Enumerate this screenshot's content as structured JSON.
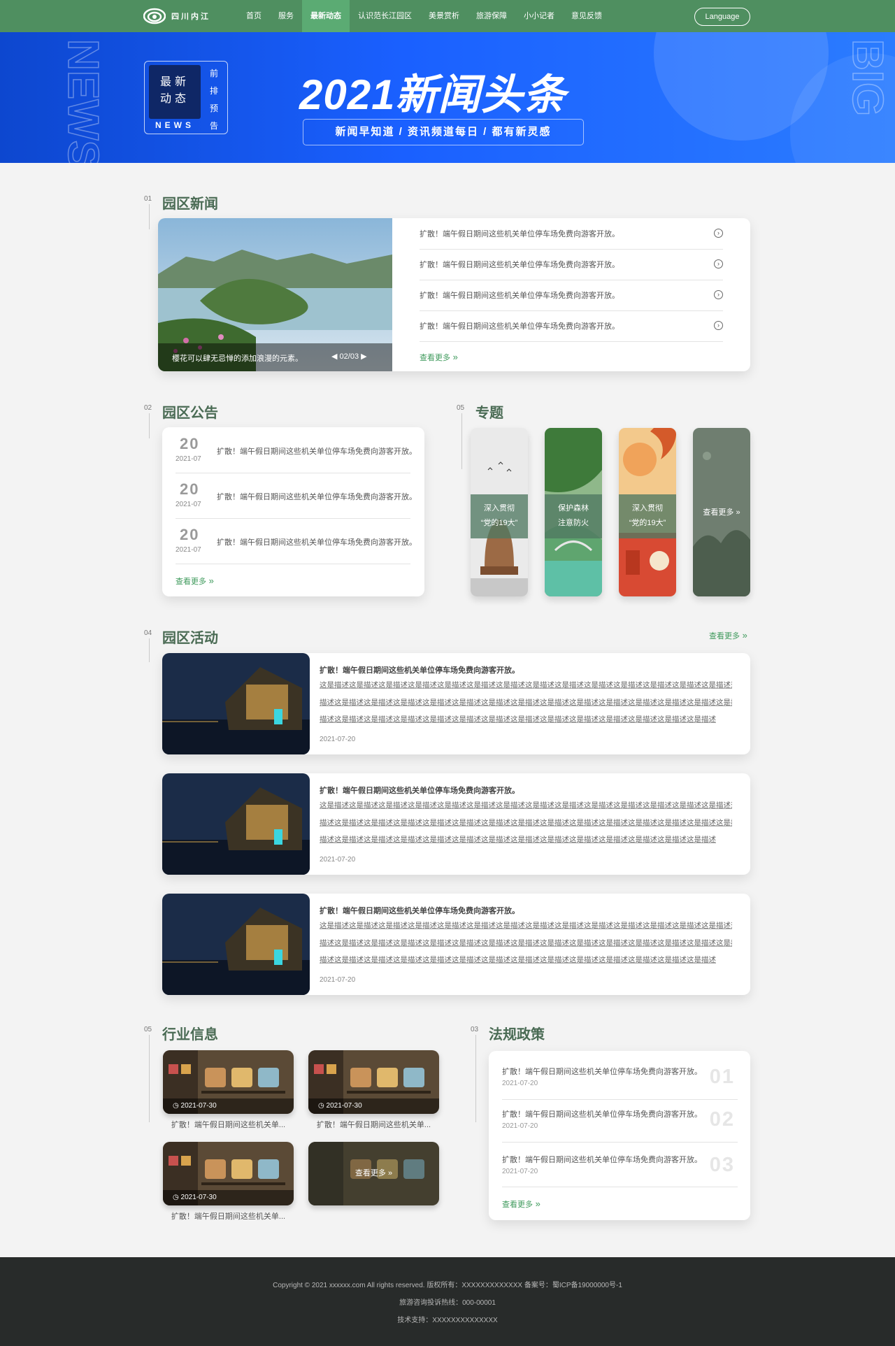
{
  "header": {
    "logo_text": "四川内江",
    "nav": [
      "首页",
      "服务",
      "最新动态",
      "认识范长江园区",
      "美景赏析",
      "旅游保障",
      "小小记者",
      "意见反馈"
    ],
    "active_index": 2,
    "language_button": "Language"
  },
  "banner": {
    "badge_main_line1": "最新",
    "badge_main_line2": "动态",
    "badge_vertical": [
      "前",
      "排",
      "预",
      "告"
    ],
    "badge_news": "NEWS",
    "title": "2021新闻头条",
    "subtitle": "新闻早知道  /  资讯频道每日  /  都有新灵感",
    "ghost_left": "NEWS",
    "ghost_right": "BIG"
  },
  "park_news": {
    "no": "01",
    "title": "园区新闻",
    "caption": "樱花可以肆无忌惮的添加浪漫的元素。",
    "pager": "02/03",
    "items": [
      "扩散！端午假日期间这些机关单位停车场免费向游客开放。",
      "扩散！端午假日期间这些机关单位停车场免费向游客开放。",
      "扩散！端午假日期间这些机关单位停车场免费向游客开放。",
      "扩散！端午假日期间这些机关单位停车场免费向游客开放。"
    ],
    "more": "查看更多"
  },
  "park_notice": {
    "no": "02",
    "title": "园区公告",
    "items": [
      {
        "day": "20",
        "ym": "2021-07",
        "text": "扩散！端午假日期间这些机关单位停车场免费向游客开放。"
      },
      {
        "day": "20",
        "ym": "2021-07",
        "text": "扩散！端午假日期间这些机关单位停车场免费向游客开放。"
      },
      {
        "day": "20",
        "ym": "2021-07",
        "text": "扩散！端午假日期间这些机关单位停车场免费向游客开放。"
      }
    ],
    "more": "查看更多"
  },
  "topics": {
    "no": "05",
    "title": "专题",
    "items": [
      {
        "line1": "深入贯彻",
        "line2": "“党的19大”"
      },
      {
        "line1": "保护森林",
        "line2": "注意防火"
      },
      {
        "line1": "深入贯彻",
        "line2": "“党的19大”"
      }
    ],
    "more": "查看更多"
  },
  "activities": {
    "no": "04",
    "title": "园区活动",
    "more": "查看更多",
    "items": [
      {
        "title": "扩散！端午假日期间这些机关单位停车场免费向游客开放。",
        "lines": [
          "这是描述这是描述这是描述这是描述这是描述这是描述这是描述这是描述这是描述这是描述这是描述这是描述这是描述这是描述这是描述这是描述这是",
          "描述这是描述这是描述这是描述这是描述这是描述这是描述这是描述这是描述这是描述这是描述这是描述这是描述这是描述这是描述这是描述这是描述这是",
          "描述这是描述这是描述这是描述这是描述这是描述这是描述这是描述这是描述这是描述这是描述这是描述这是描述这是描述"
        ],
        "date": "2021-07-20"
      },
      {
        "title": "扩散！端午假日期间这些机关单位停车场免费向游客开放。",
        "lines": [
          "这是描述这是描述这是描述这是描述这是描述这是描述这是描述这是描述这是描述这是描述这是描述这是描述这是描述这是描述这是描述这是描述这是",
          "描述这是描述这是描述这是描述这是描述这是描述这是描述这是描述这是描述这是描述这是描述这是描述这是描述这是描述这是描述这是描述这是描述这是",
          "描述这是描述这是描述这是描述这是描述这是描述这是描述这是描述这是描述这是描述这是描述这是描述这是描述这是描述"
        ],
        "date": "2021-07-20"
      },
      {
        "title": "扩散！端午假日期间这些机关单位停车场免费向游客开放。",
        "lines": [
          "这是描述这是描述这是描述这是描述这是描述这是描述这是描述这是描述这是描述这是描述这是描述这是描述这是描述这是描述这是描述这是描述这是",
          "描述这是描述这是描述这是描述这是描述这是描述这是描述这是描述这是描述这是描述这是描述这是描述这是描述这是描述这是描述这是描述这是描述这是",
          "描述这是描述这是描述这是描述这是描述这是描述这是描述这是描述这是描述这是描述这是描述这是描述这是描述这是描述"
        ],
        "date": "2021-07-20"
      }
    ]
  },
  "industry": {
    "no": "05",
    "title": "行业信息",
    "items": [
      {
        "date": "2021-07-30",
        "caption": "扩散！端午假日期间这些机关单..."
      },
      {
        "date": "2021-07-30",
        "caption": "扩散！端午假日期间这些机关单..."
      },
      {
        "date": "2021-07-30",
        "caption": "扩散！端午假日期间这些机关单..."
      }
    ],
    "more": "查看更多"
  },
  "laws": {
    "no": "03",
    "title": "法规政策",
    "items": [
      {
        "text": "扩散！端午假日期间这些机关单位停车场免费向游客开放。",
        "date": "2021-07-20",
        "no": "01"
      },
      {
        "text": "扩散！端午假日期间这些机关单位停车场免费向游客开放。",
        "date": "2021-07-20",
        "no": "02"
      },
      {
        "text": "扩散！端午假日期间这些机关单位停车场免费向游客开放。",
        "date": "2021-07-20",
        "no": "03"
      }
    ],
    "more": "查看更多"
  },
  "footer": {
    "line1": "Copyright © 2021  xxxxxx.com All rights reserved.  版权所有：XXXXXXXXXXXXX  备案号：蜀ICP备19000000号-1",
    "line2": "旅游咨询投诉热线：000-00001",
    "line3": "技术支持：XXXXXXXXXXXXXX"
  },
  "colors": {
    "primary_green": "#4f8f60",
    "active_green": "#5bab73",
    "banner_blue": "#1a60ff",
    "link_green": "#3f9a5c",
    "footer_bg": "#282b2a"
  }
}
